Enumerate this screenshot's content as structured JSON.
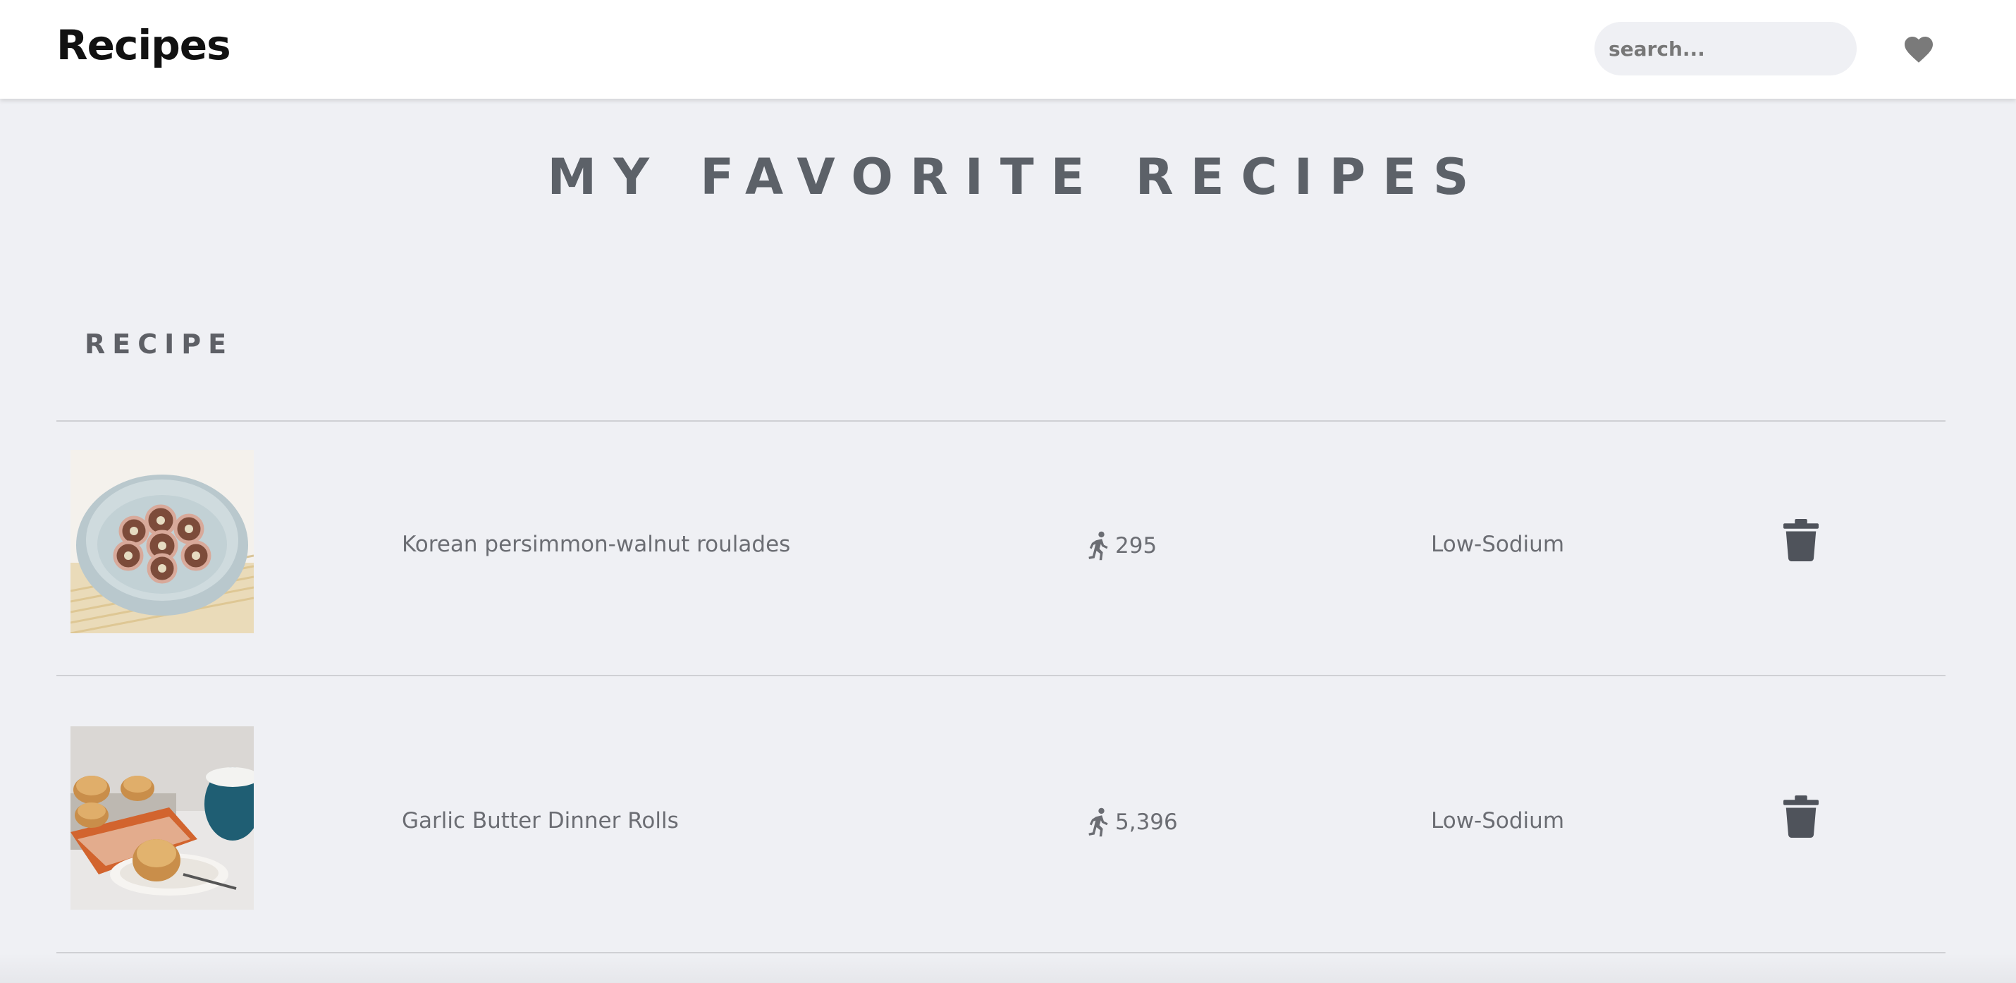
{
  "header": {
    "brand": "Recipes",
    "search_placeholder": "search...",
    "favorites_icon": "heart-icon"
  },
  "main": {
    "title": "MY FAVORITE RECIPES",
    "column_header": "RECIPE"
  },
  "recipes": [
    {
      "name": "Korean persimmon-walnut roulades",
      "calories": "295",
      "calories_icon": "running-person-icon",
      "diet_label": "Low-Sodium",
      "delete_icon": "trash-icon",
      "image": "plate-of-persimmon-roulades"
    },
    {
      "name": "Garlic Butter Dinner Rolls",
      "calories": "5,396",
      "calories_icon": "running-person-icon",
      "diet_label": "Low-Sodium",
      "delete_icon": "trash-icon",
      "image": "plate-of-dinner-rolls"
    }
  ],
  "colors": {
    "background": "#eff0f4",
    "header_background": "#ffffff",
    "title": "#5c6168",
    "icon": "#4f535b",
    "heart": "#7a7a7a"
  }
}
